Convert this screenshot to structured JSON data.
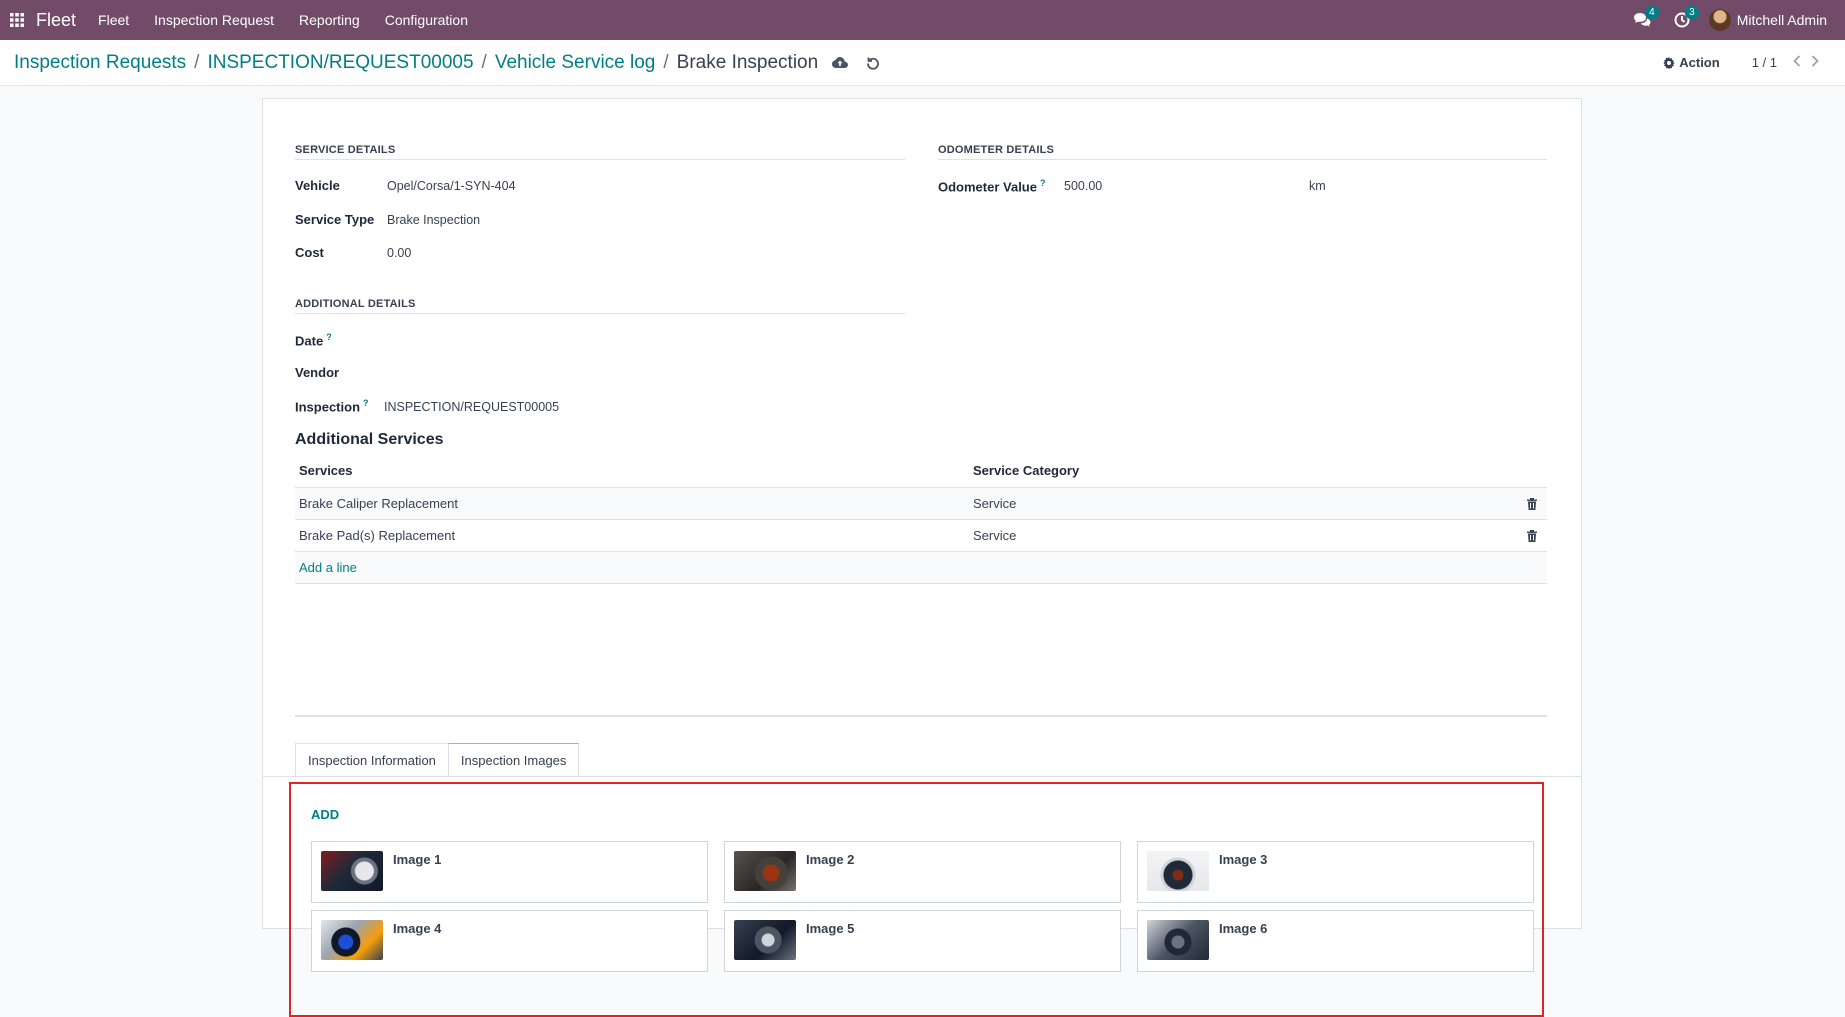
{
  "navbar": {
    "brand": "Fleet",
    "menu": [
      "Fleet",
      "Inspection Request",
      "Reporting",
      "Configuration"
    ],
    "messages_count": "4",
    "activities_count": "3",
    "user_name": "Mitchell Admin",
    "bg_color": "#714b67"
  },
  "breadcrumb": {
    "items": [
      "Inspection Requests",
      "INSPECTION/REQUEST00005",
      "Vehicle Service log"
    ],
    "current": "Brake Inspection",
    "separator": "/"
  },
  "control": {
    "action_label": "Action",
    "pager": "1 / 1"
  },
  "form": {
    "service_details": {
      "title": "SERVICE DETAILS",
      "vehicle_label": "Vehicle",
      "vehicle_value": "Opel/Corsa/1-SYN-404",
      "service_type_label": "Service Type",
      "service_type_value": "Brake Inspection",
      "cost_label": "Cost",
      "cost_value": "0.00"
    },
    "odometer_details": {
      "title": "ODOMETER DETAILS",
      "odometer_label": "Odometer Value",
      "odometer_help": "?",
      "odometer_value": "500.00",
      "odometer_unit": "km"
    },
    "additional_details": {
      "title": "ADDITIONAL DETAILS",
      "date_label": "Date",
      "date_help": "?",
      "vendor_label": "Vendor",
      "inspection_label": "Inspection",
      "inspection_help": "?",
      "inspection_value": "INSPECTION/REQUEST00005"
    },
    "additional_services": {
      "title": "Additional Services",
      "headers": {
        "services": "Services",
        "category": "Service Category"
      },
      "rows": [
        {
          "service": "Brake Caliper Replacement",
          "category": "Service"
        },
        {
          "service": "Brake Pad(s) Replacement",
          "category": "Service"
        }
      ],
      "add_line": "Add a line"
    },
    "tabs": [
      "Inspection Information",
      "Inspection Images"
    ],
    "active_tab": "Inspection Images",
    "images": {
      "add_label": "ADD",
      "items": [
        "Image 1",
        "Image 2",
        "Image 3",
        "Image 4",
        "Image 5",
        "Image 6"
      ]
    }
  },
  "icons": {
    "apps": "apps-grid-icon",
    "chat": "chat-icon",
    "activity": "clock-icon",
    "save": "cloud-upload-icon",
    "discard": "undo-icon",
    "action": "gear-icon",
    "prev": "chevron-left-icon",
    "next": "chevron-right-icon",
    "delete": "trash-icon"
  },
  "colors": {
    "accent": "#017e84",
    "highlight_border": "#dc2626"
  }
}
